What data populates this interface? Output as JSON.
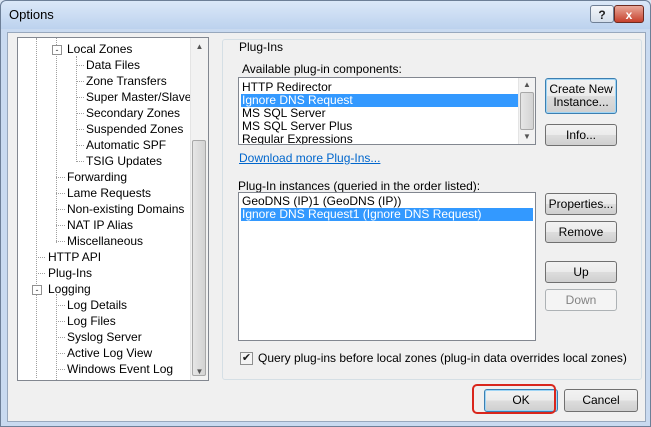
{
  "window": {
    "title": "Options",
    "help_label": "?",
    "close_label": "x"
  },
  "tree": {
    "nodes": [
      {
        "label": "Local Zones",
        "toggle": "-"
      },
      {
        "label": "Data Files"
      },
      {
        "label": "Zone Transfers"
      },
      {
        "label": "Super Master/Slave"
      },
      {
        "label": "Secondary Zones"
      },
      {
        "label": "Suspended Zones"
      },
      {
        "label": "Automatic SPF"
      },
      {
        "label": "TSIG Updates"
      },
      {
        "label": "Forwarding"
      },
      {
        "label": "Lame Requests"
      },
      {
        "label": "Non-existing Domains"
      },
      {
        "label": "NAT IP Alias"
      },
      {
        "label": "Miscellaneous"
      },
      {
        "label": "HTTP API"
      },
      {
        "label": "Plug-Ins"
      },
      {
        "label": "Logging",
        "toggle": "-"
      },
      {
        "label": "Log Details"
      },
      {
        "label": "Log Files"
      },
      {
        "label": "Syslog Server"
      },
      {
        "label": "Active Log View"
      },
      {
        "label": "Windows Event Log"
      }
    ]
  },
  "plugins": {
    "group_title": "Plug-Ins",
    "available_label": "Available plug-in components:",
    "available": [
      {
        "label": "HTTP Redirector",
        "selected": false
      },
      {
        "label": "Ignore DNS Request",
        "selected": true
      },
      {
        "label": "MS SQL Server",
        "selected": false
      },
      {
        "label": "MS SQL Server Plus",
        "selected": false
      },
      {
        "label": "Regular Expressions",
        "selected": false
      }
    ],
    "create_button": "Create New Instance...",
    "info_button": "Info...",
    "download_link": "Download more Plug-Ins...",
    "instances_label": "Plug-In instances (queried in the order listed):",
    "instances": [
      {
        "label": "GeoDNS (IP)1 (GeoDNS (IP))",
        "selected": false
      },
      {
        "label": "Ignore DNS Request1 (Ignore DNS Request)",
        "selected": true
      }
    ],
    "properties_button": "Properties...",
    "remove_button": "Remove",
    "up_button": "Up",
    "down_button": "Down",
    "query_checkbox_label": "Query plug-ins before local zones (plug-in data overrides local zones)",
    "query_checkbox_checked": true
  },
  "footer": {
    "ok_label": "OK",
    "cancel_label": "Cancel"
  },
  "colors": {
    "selection": "#3399ff",
    "link": "#0066cc",
    "highlight": "#d9261c"
  }
}
